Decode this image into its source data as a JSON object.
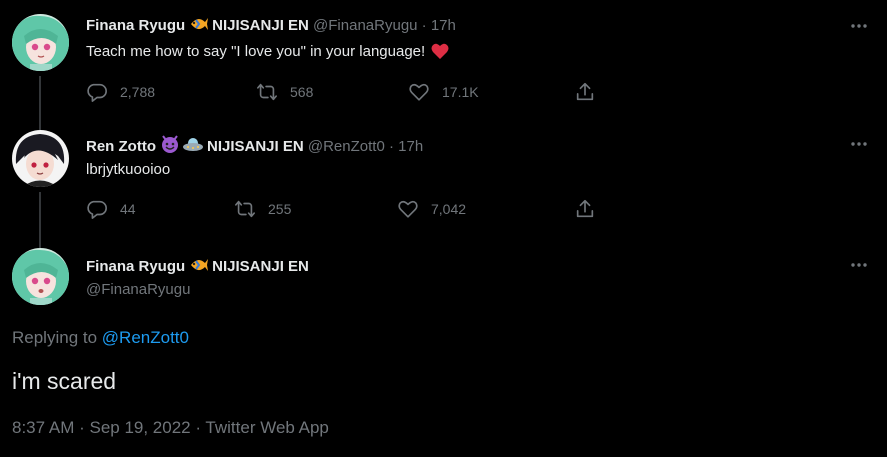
{
  "tweets": [
    {
      "name": "Finana Ryugu",
      "emoji": "tropical-fish",
      "org": "NIJISANJI EN",
      "handle": "@FinanaRyugu",
      "separator": "·",
      "time": "17h",
      "text": "Teach me how to say \"I love you\" in your language!",
      "trailing_emoji": "red-heart",
      "replies": "2,788",
      "retweets": "568",
      "likes": "17.1K"
    },
    {
      "name": "Ren Zotto",
      "emoji": "smiling-devil ufo",
      "org": "NIJISANJI EN",
      "handle": "@RenZott0",
      "separator": "·",
      "time": "17h",
      "text": "lbrjytkuooioo",
      "replies": "44",
      "retweets": "255",
      "likes": "7,042"
    }
  ],
  "main": {
    "name": "Finana Ryugu",
    "emoji": "tropical-fish",
    "org": "NIJISANJI EN",
    "handle": "@FinanaRyugu",
    "replying_prefix": "Replying to",
    "replying_to": "@RenZott0",
    "text": "i'm scared",
    "timestamp": "8:37 AM · Sep 19, 2022 · Twitter Web App"
  },
  "colors": {
    "background": "#000000",
    "text": "#e7e9ea",
    "muted": "#71767b",
    "link": "#1d9bf0",
    "heart": "#e0245e"
  }
}
